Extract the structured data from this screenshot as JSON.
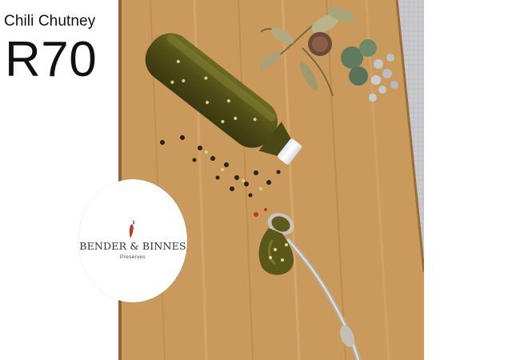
{
  "product": {
    "name": "Chili Chutney",
    "price": "R70"
  },
  "logo": {
    "brand": "BENDER & BINNES",
    "tagline": "Preserves",
    "icon": "chili-pepper-icon"
  },
  "colors": {
    "board": "#c99a5c",
    "chutney": "#5a5a1e",
    "lid": "#eef3f6",
    "cloth": "#c3c7d0",
    "chili_red": "#c0392b"
  }
}
